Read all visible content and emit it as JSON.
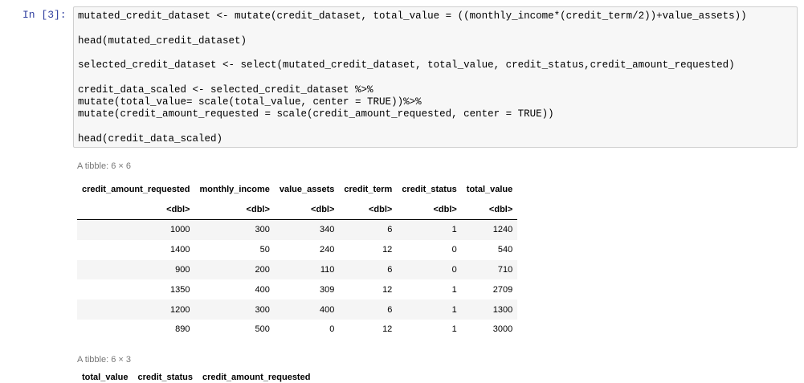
{
  "cell": {
    "prompt": "In [3]:",
    "code_lines": [
      "mutated_credit_dataset <- mutate(credit_dataset, total_value = ((monthly_income*(credit_term/2))+value_assets))",
      "",
      "head(mutated_credit_dataset)",
      "",
      "selected_credit_dataset <- select(mutated_credit_dataset, total_value, credit_status,credit_amount_requested)",
      "",
      "credit_data_scaled <- selected_credit_dataset %>%",
      "mutate(total_value= scale(total_value, center = TRUE))%>%",
      "mutate(credit_amount_requested = scale(credit_amount_requested, center = TRUE))",
      "",
      "head(credit_data_scaled)"
    ]
  },
  "output1": {
    "caption": "A tibble: 6 × 6",
    "columns": [
      "credit_amount_requested",
      "monthly_income",
      "value_assets",
      "credit_term",
      "credit_status",
      "total_value"
    ],
    "types": [
      "<dbl>",
      "<dbl>",
      "<dbl>",
      "<dbl>",
      "<dbl>",
      "<dbl>"
    ],
    "rows": [
      [
        "1000",
        "300",
        "340",
        "6",
        "1",
        "1240"
      ],
      [
        "1400",
        "50",
        "240",
        "12",
        "0",
        "540"
      ],
      [
        "900",
        "200",
        "110",
        "6",
        "0",
        "710"
      ],
      [
        "1350",
        "400",
        "309",
        "12",
        "1",
        "2709"
      ],
      [
        "1200",
        "300",
        "400",
        "6",
        "1",
        "1300"
      ],
      [
        "890",
        "500",
        "0",
        "12",
        "1",
        "3000"
      ]
    ]
  },
  "output2": {
    "caption": "A tibble: 6 × 3",
    "columns": [
      "total_value",
      "credit_status",
      "credit_amount_requested"
    ]
  }
}
